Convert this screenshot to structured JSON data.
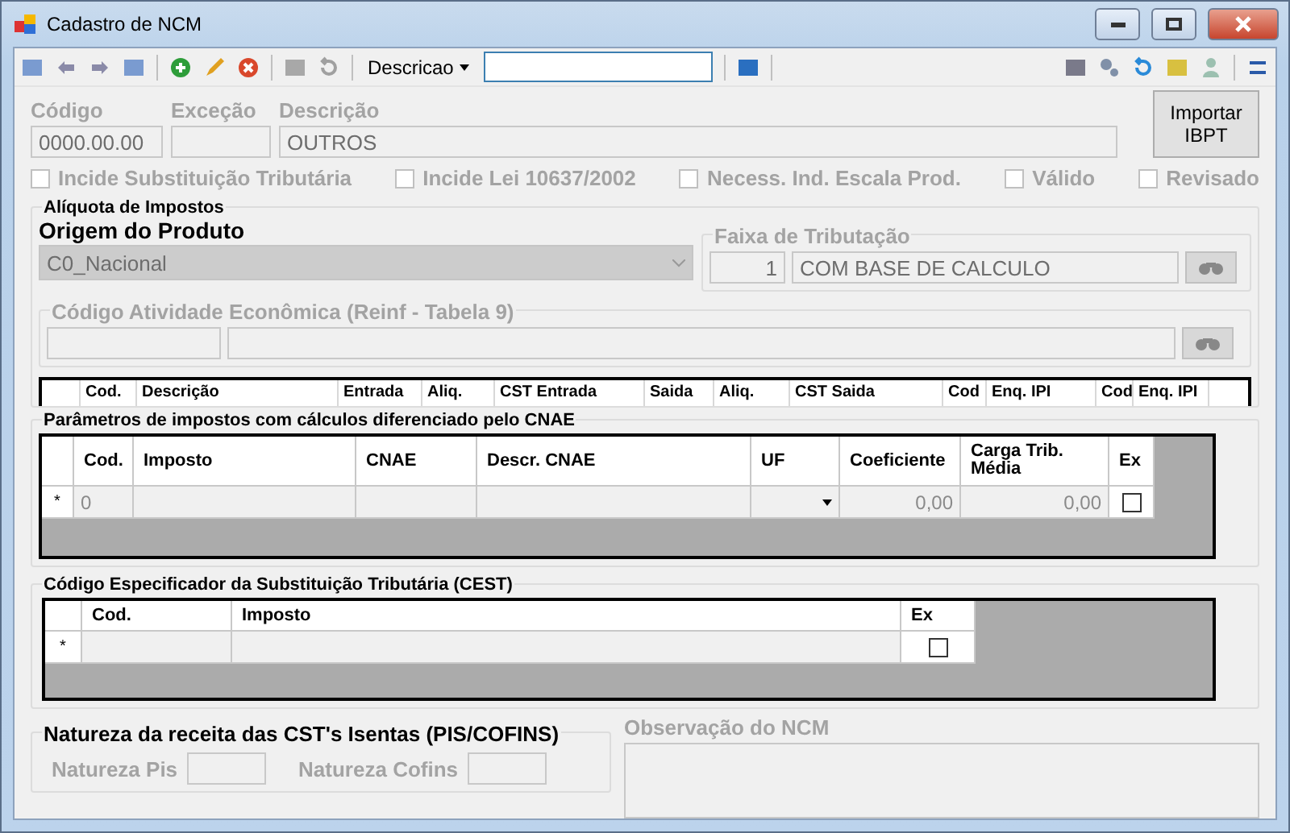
{
  "window": {
    "title": "Cadastro de NCM"
  },
  "toolbar": {
    "search_by": "Descricao"
  },
  "form": {
    "codigo": {
      "label": "Código",
      "value": "0000.00.00"
    },
    "excecao": {
      "label": "Exceção"
    },
    "descricao": {
      "label": "Descrição",
      "value": "OUTROS"
    },
    "import_button": "Importar IBPT"
  },
  "checkboxes": [
    {
      "label": "Incide Substituição Tributária",
      "checked": false
    },
    {
      "label": "Incide Lei 10637/2002",
      "checked": false
    },
    {
      "label": "Necess. Ind. Escala Prod.",
      "checked": false
    },
    {
      "label": "Válido",
      "checked": false
    },
    {
      "label": "Revisado",
      "checked": false
    }
  ],
  "aliquota": {
    "title": "Alíquota de Impostos",
    "origem_label": "Origem do Produto",
    "origem_value": "C0_Nacional",
    "faixa": {
      "title": "Faixa de Tributação",
      "code": "1",
      "value": "COM BASE DE CALCULO"
    },
    "atividade": {
      "title": "Código Atividade Econômica (Reinf - Tabela 9)"
    },
    "columns": [
      "Cod.",
      "Descrição",
      "Entrada",
      "Aliq.",
      "CST Entrada",
      "Saida",
      "Aliq.",
      "CST Saida",
      "Cod",
      "Enq. IPI",
      "Cod",
      "Enq. IPI"
    ]
  },
  "cnae": {
    "title": "Parâmetros de impostos com cálculos diferenciado pelo CNAE",
    "columns": [
      "Cod.",
      "Imposto",
      "CNAE",
      "Descr. CNAE",
      "UF",
      "Coeficiente",
      "Carga Trib. Média",
      "Ex"
    ],
    "rows": [
      {
        "marker": "*",
        "cod": "0",
        "coeficiente": "0,00",
        "carga": "0,00",
        "ex": false
      }
    ]
  },
  "cest": {
    "title": "Código Especificador da Substituição Tributária (CEST)",
    "columns": [
      "Cod.",
      "Imposto",
      "Ex"
    ],
    "rows": [
      {
        "marker": "*",
        "ex": false
      }
    ]
  },
  "natureza": {
    "title": "Natureza da receita das CST's Isentas (PIS/COFINS)",
    "pis_label": "Natureza Pis",
    "cofins_label": "Natureza Cofins"
  },
  "observacao": {
    "label": "Observação do NCM"
  }
}
